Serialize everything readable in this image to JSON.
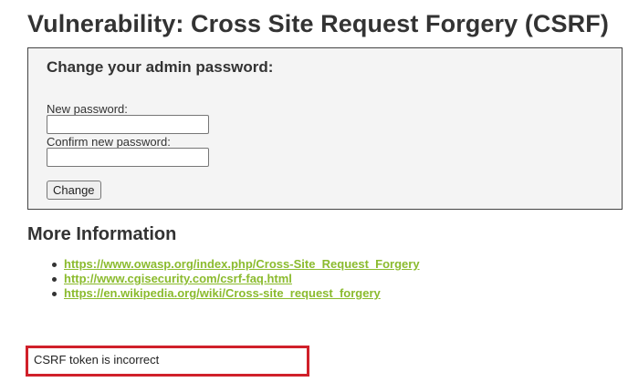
{
  "page": {
    "title": "Vulnerability: Cross Site Request Forgery (CSRF)"
  },
  "form": {
    "heading": "Change your admin password:",
    "new_password_label": "New password:",
    "new_password_value": "",
    "confirm_password_label": "Confirm new password:",
    "confirm_password_value": "",
    "submit_label": "Change"
  },
  "more_info": {
    "heading": "More Information",
    "links": [
      {
        "text": "https://www.owasp.org/index.php/Cross-Site_Request_Forgery"
      },
      {
        "text": "http://www.cgisecurity.com/csrf-faq.html"
      },
      {
        "text": "https://en.wikipedia.org/wiki/Cross-site_request_forgery"
      }
    ]
  },
  "message": {
    "text": "CSRF token is incorrect"
  },
  "colors": {
    "link": "#8bbb2e",
    "error_border": "#d0202a",
    "form_background": "#f4f4f4"
  }
}
